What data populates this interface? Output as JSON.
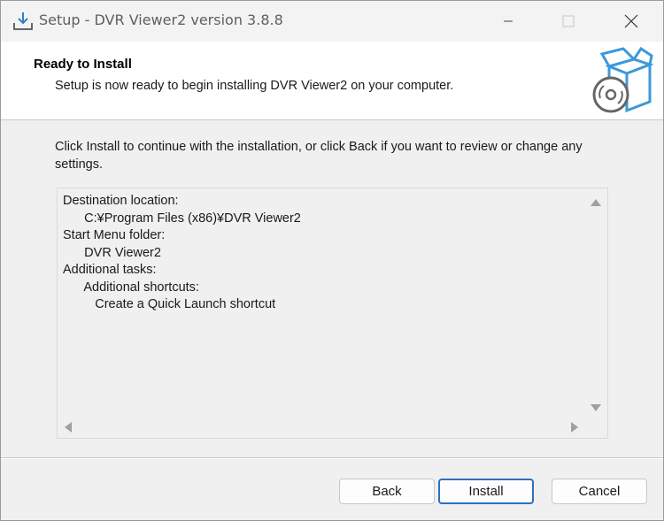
{
  "window": {
    "title": "Setup - DVR Viewer2 version 3.8.8",
    "icons": {
      "app": "setup-download-icon",
      "minimize": "minimize-icon",
      "maximize": "maximize-icon",
      "close": "close-icon"
    }
  },
  "header": {
    "title": "Ready to Install",
    "subtitle": "Setup is now ready to begin installing DVR Viewer2 on your computer.",
    "image": "box-disc-icon"
  },
  "intro_text": "Click Install to continue with the installation, or click Back if you want to review or change any settings.",
  "memo": {
    "lines": [
      "Destination location:",
      "      C:¥Program Files (x86)¥DVR Viewer2",
      "",
      "Start Menu folder:",
      "      DVR Viewer2",
      "",
      "Additional tasks:",
      "      Additional shortcuts:",
      "         Create a Quick Launch shortcut"
    ]
  },
  "buttons": {
    "back": "Back",
    "install": "Install",
    "cancel": "Cancel"
  },
  "colors": {
    "accent": "#2f6fc0",
    "icon_blue": "#3a9ad9",
    "dialog_bg": "#f0f0f0"
  }
}
